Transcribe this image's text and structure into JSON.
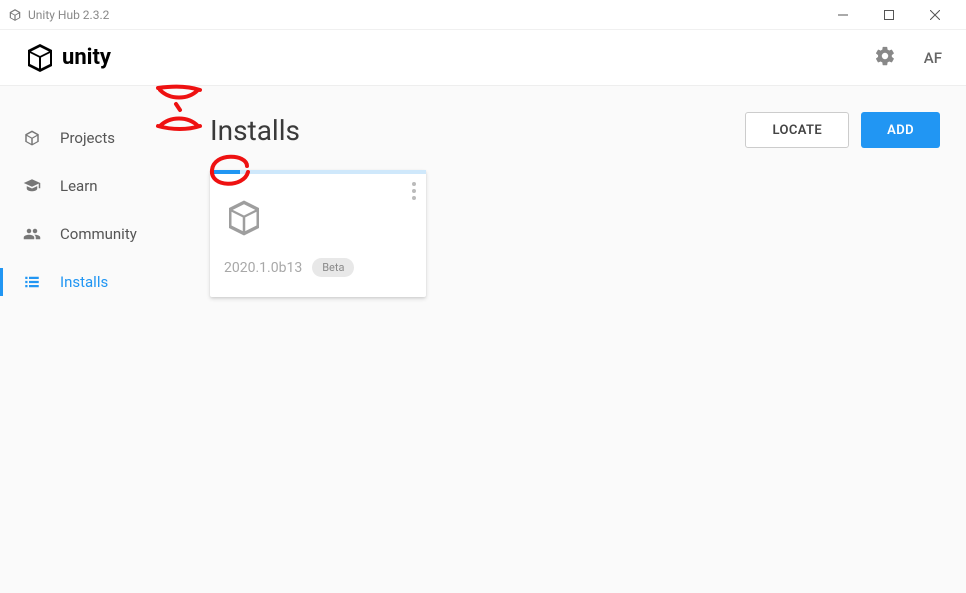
{
  "window": {
    "title": "Unity Hub 2.3.2"
  },
  "topbar": {
    "brand": "unity",
    "user_initials": "AF"
  },
  "sidebar": {
    "items": [
      {
        "label": "Projects",
        "icon": "cube-icon",
        "active": false
      },
      {
        "label": "Learn",
        "icon": "graduation-cap-icon",
        "active": false
      },
      {
        "label": "Community",
        "icon": "people-icon",
        "active": false
      },
      {
        "label": "Installs",
        "icon": "list-icon",
        "active": true
      }
    ]
  },
  "page": {
    "title": "Installs",
    "actions": {
      "locate": "LOCATE",
      "add": "ADD"
    }
  },
  "installs": [
    {
      "version": "2020.1.0b13",
      "badge": "Beta",
      "progress_percent": 14
    }
  ],
  "colors": {
    "accent": "#2196f3"
  }
}
